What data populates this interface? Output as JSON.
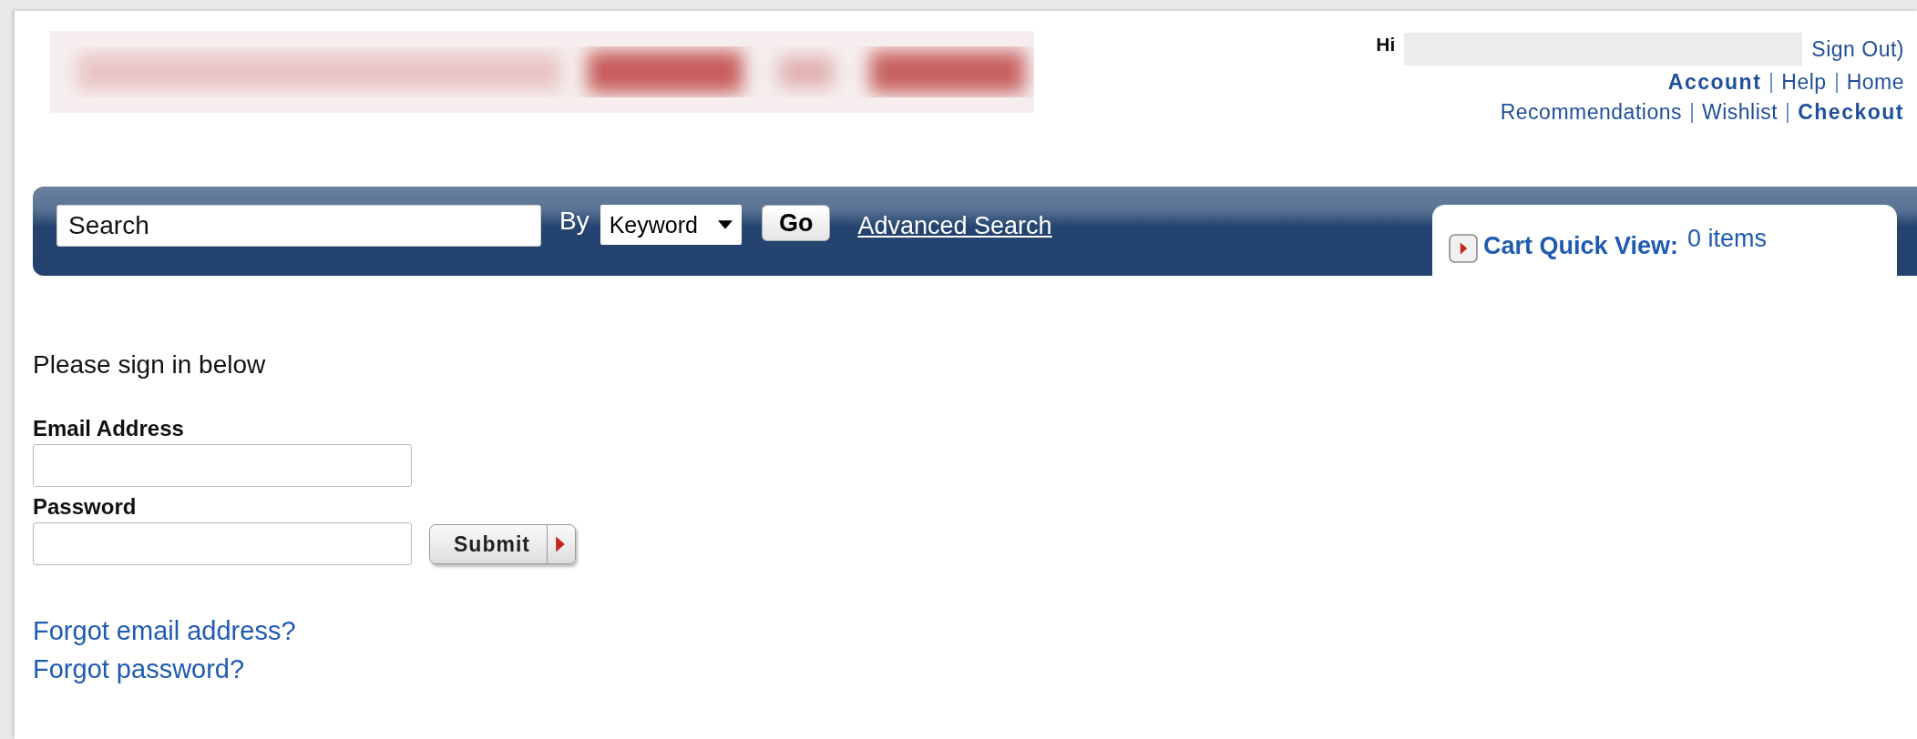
{
  "header": {
    "greeting": "Hi",
    "sign_out": "Sign Out)",
    "links_row_1": [
      {
        "label": "Account",
        "bold": true
      },
      {
        "label": "Help",
        "bold": false
      },
      {
        "label": "Home",
        "bold": false
      }
    ],
    "links_row_2": [
      {
        "label": "Recommendations",
        "bold": false
      },
      {
        "label": "Wishlist",
        "bold": false
      },
      {
        "label": "Checkout",
        "bold": true
      }
    ]
  },
  "search_bar": {
    "placeholder": "Search",
    "by_label": "By",
    "select_value": "Keyword",
    "go_button": "Go",
    "advanced_link": "Advanced Search"
  },
  "cart": {
    "label": "Cart Quick View:",
    "count": "0 items"
  },
  "sign_in": {
    "heading": "Please sign in below",
    "email_label": "Email Address",
    "password_label": "Password",
    "submit_button": "Submit",
    "links": [
      "Forgot email address?",
      "Forgot password?"
    ]
  }
}
